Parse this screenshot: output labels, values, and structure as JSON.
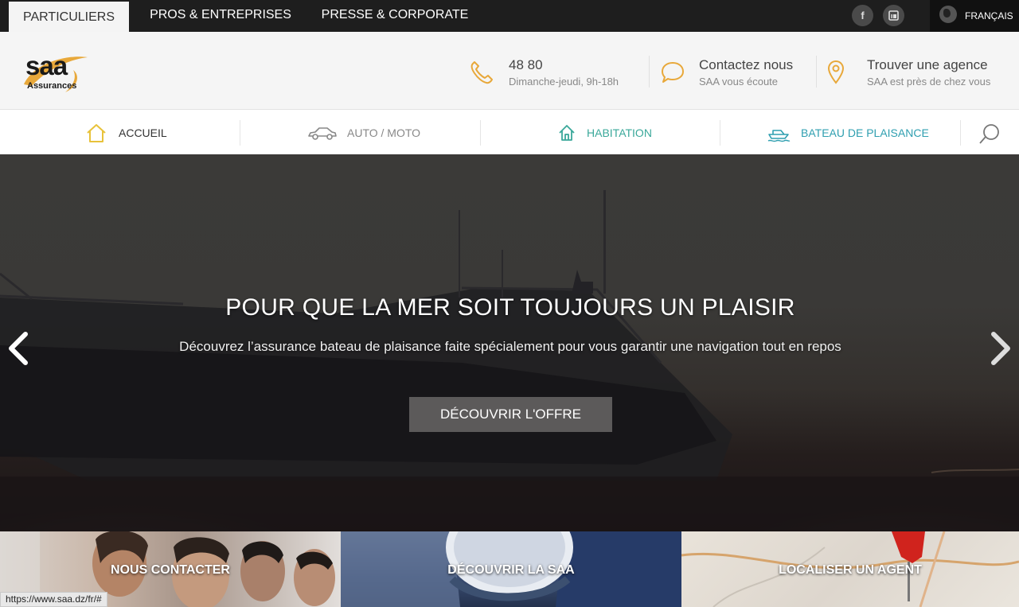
{
  "topbar": {
    "tabs": [
      "PARTICULIERS",
      "PROS & ENTREPRISES",
      "PRESSE & CORPORATE"
    ],
    "social": [
      "facebook-icon",
      "linkedin-icon"
    ],
    "language": "FRANÇAIS"
  },
  "header": {
    "logo": {
      "brand": "saa",
      "tagline": "Assurances"
    },
    "phone": {
      "number": "48 80",
      "hours": "Dimanche-jeudi, 9h-18h"
    },
    "contact": {
      "title": "Contactez nous",
      "sub": "SAA vous écoute"
    },
    "agency": {
      "title": "Trouver une agence",
      "sub": "SAA est près de chez vous"
    }
  },
  "nav": {
    "items": [
      "ACCUEIL",
      "AUTO / MOTO",
      "HABITATION",
      "BATEAU DE PLAISANCE"
    ],
    "colors": {
      "accueil": "#333333",
      "auto": "#888888",
      "habitation": "#3aa89a",
      "bateau": "#2f9fb0"
    }
  },
  "hero": {
    "title": "POUR QUE LA MER SOIT TOUJOURS UN PLAISIR",
    "subtitle": "Découvrez l’assurance bateau de plaisance faite spécialement pour vous garantir une navigation tout en repos",
    "cta": "DÉCOUVRIR L'OFFRE"
  },
  "tiles": [
    "NOUS CONTACTER",
    "DÉCOUVRIR LA SAA",
    "LOCALISER UN AGENT"
  ],
  "status_url": "https://www.saa.dz/fr/#",
  "colors": {
    "accent": "#e8a83a",
    "topbar": "#1e1e1e"
  }
}
